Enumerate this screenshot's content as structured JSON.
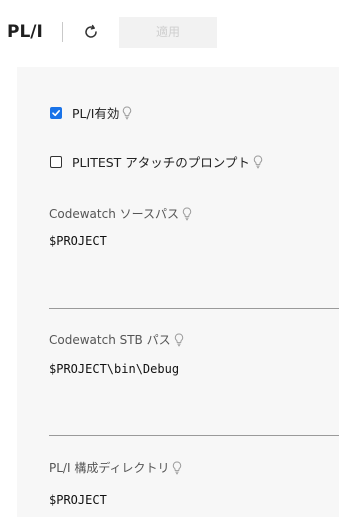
{
  "toolbar": {
    "title": "PL/I",
    "refresh_icon": "refresh-icon",
    "apply_label": "適用"
  },
  "settings": {
    "pli_enabled": {
      "label": "PL/I有効",
      "checked": true,
      "hint_icon": "lightbulb-icon"
    },
    "plitest_prompt": {
      "label": "PLITEST アタッチのプロンプト",
      "checked": false,
      "hint_icon": "lightbulb-icon"
    },
    "codewatch_source_path": {
      "label": "Codewatch ソースパス",
      "value": "$PROJECT",
      "hint_icon": "lightbulb-icon"
    },
    "codewatch_stb_path": {
      "label": "Codewatch STB パス",
      "value": "$PROJECT\\bin\\Debug",
      "hint_icon": "lightbulb-icon"
    },
    "pli_config_dir": {
      "label": "PL/I 構成ディレクトリ",
      "value": "$PROJECT",
      "hint_icon": "lightbulb-icon"
    }
  },
  "colors": {
    "accent": "#1a73e8",
    "panel_bg": "#f7f7f7",
    "disabled_button_bg": "#f2f2f2"
  }
}
